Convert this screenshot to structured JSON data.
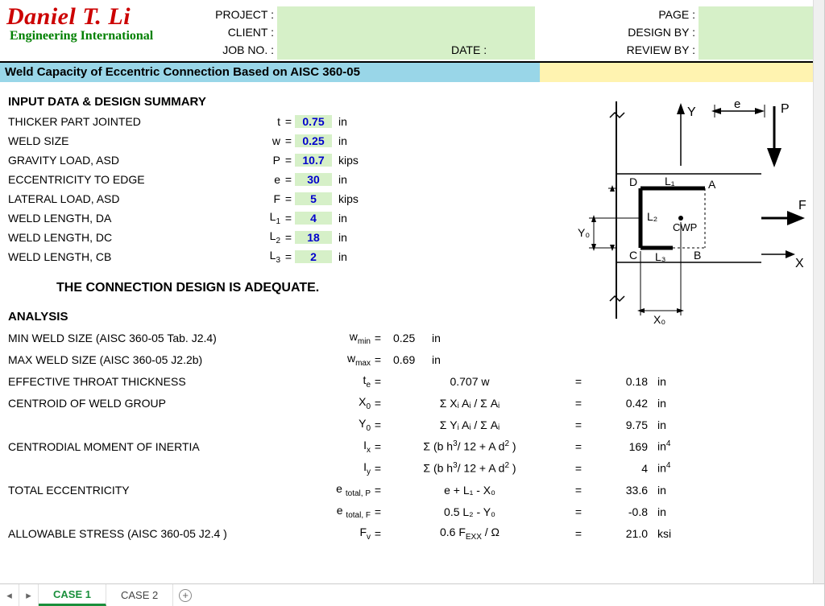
{
  "logo": {
    "main": "Daniel T. Li",
    "sub": "Engineering International"
  },
  "meta": {
    "project_label": "PROJECT :",
    "client_label": "CLIENT :",
    "jobno_label": "JOB NO. :",
    "date_label": "DATE :",
    "page_label": "PAGE :",
    "design_label": "DESIGN BY :",
    "review_label": "REVIEW BY :"
  },
  "title": "Weld Capacity of Eccentric Connection Based on AISC 360-05",
  "input_header": "INPUT DATA & DESIGN SUMMARY",
  "inputs": [
    {
      "label": "THICKER PART JOINTED",
      "sym": "t",
      "val": "0.75",
      "unit": "in"
    },
    {
      "label": "WELD SIZE",
      "sym": "w",
      "val": "0.25",
      "unit": "in"
    },
    {
      "label": "GRAVITY LOAD, ASD",
      "sym": "P",
      "val": "10.7",
      "unit": "kips"
    },
    {
      "label": "ECCENTRICITY TO EDGE",
      "sym": "e",
      "val": "30",
      "unit": "in"
    },
    {
      "label": "LATERAL LOAD, ASD",
      "sym": "F",
      "val": "5",
      "unit": "kips"
    },
    {
      "label": "WELD LENGTH, DA",
      "sym": "L1",
      "sub": "1",
      "val": "4",
      "unit": "in"
    },
    {
      "label": "WELD LENGTH, DC",
      "sym": "L2",
      "sub": "2",
      "val": "18",
      "unit": "in"
    },
    {
      "label": "WELD LENGTH, CB",
      "sym": "L3",
      "sub": "3",
      "val": "2",
      "unit": "in"
    }
  ],
  "adequate": "THE CONNECTION DESIGN IS ADEQUATE.",
  "analysis_header": "ANALYSIS",
  "analysis": [
    {
      "label": "MIN WELD SIZE (AISC 360-05 Tab. J2.4)",
      "sym": "w",
      "sub": "min",
      "expr": "0.25",
      "unit": "in",
      "noEq": true
    },
    {
      "label": "MAX WELD SIZE (AISC 360-05 J2.2b)",
      "sym": "w",
      "sub": "max",
      "expr": "0.69",
      "unit": "in",
      "noEq": true
    },
    {
      "label": "EFFECTIVE THROAT THICKNESS",
      "sym": "t",
      "sub": "e",
      "expr": "0.707 w",
      "val": "0.18",
      "unit": "in"
    },
    {
      "label": "CENTROID OF WELD GROUP",
      "sym": "X",
      "sub": "0",
      "expr": "Σ Xᵢ Aᵢ / Σ Aᵢ",
      "val": "0.42",
      "unit": "in"
    },
    {
      "label": "",
      "sym": "Y",
      "sub": "0",
      "expr": "Σ Yᵢ Aᵢ / Σ Aᵢ",
      "val": "9.75",
      "unit": "in"
    },
    {
      "label": "CENTRODIAL MOMENT OF INERTIA",
      "sym": "I",
      "sub": "x",
      "expr": "Σ (b h³/ 12 + A d² )",
      "val": "169",
      "unit": "in⁴"
    },
    {
      "label": "",
      "sym": "I",
      "sub": "y",
      "expr": "Σ (b h³/ 12 + A d² )",
      "val": "4",
      "unit": "in⁴"
    },
    {
      "label": "TOTAL ECCENTRICITY",
      "sym": "e ",
      "sub": "total, P",
      "expr": "e + L₁ - X₀",
      "val": "33.6",
      "unit": "in"
    },
    {
      "label": "",
      "sym": "e ",
      "sub": "total, F",
      "expr": "0.5 L₂ - Y₀",
      "val": "-0.8",
      "unit": "in"
    },
    {
      "label": "ALLOWABLE STRESS (AISC 360-05 J2.4 )",
      "sym": "F",
      "sub": "v",
      "expr": "0.6 F_EXX / Ω",
      "val": "21.0",
      "unit": "ksi"
    }
  ],
  "diagram": {
    "labels": {
      "Y": "Y",
      "X": "X",
      "P": "P",
      "F": "F",
      "e": "e",
      "L1": "L₁",
      "L2": "L₂",
      "L3": "L₃",
      "X0": "X₀",
      "Y0": "Y₀",
      "A": "A",
      "B": "B",
      "C": "C",
      "D": "D",
      "CWP": "CWP"
    }
  },
  "tabs": {
    "case1": "CASE 1",
    "case2": "CASE 2"
  }
}
